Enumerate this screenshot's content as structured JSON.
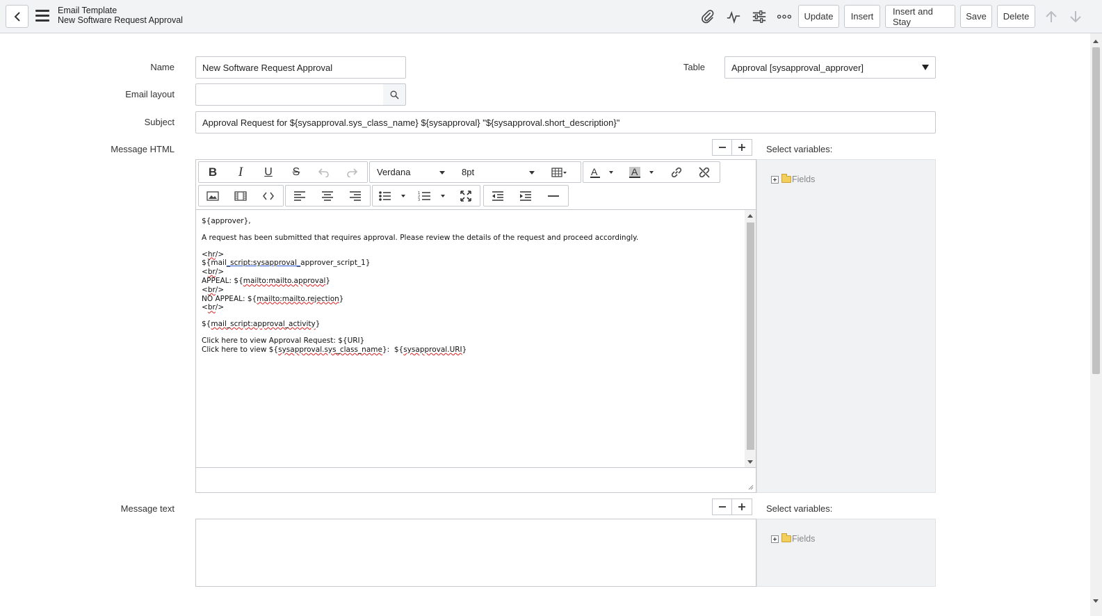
{
  "header": {
    "title": "Email Template",
    "subtitle": "New Software Request Approval",
    "buttons": {
      "update": "Update",
      "insert": "Insert",
      "insert_and_stay": "Insert and Stay",
      "save": "Save",
      "delete": "Delete"
    },
    "icons": [
      "back-icon",
      "menu-icon",
      "paperclip-icon",
      "activity-icon",
      "sliders-icon",
      "more-icon",
      "arrow-up-icon",
      "arrow-down-icon"
    ]
  },
  "form": {
    "name_label": "Name",
    "name_value": "New Software Request Approval",
    "email_layout_label": "Email layout",
    "email_layout_value": "",
    "table_label": "Table",
    "table_value": "Approval [sysapproval_approver]",
    "subject_label": "Subject",
    "subject_value": "Approval Request for ${sysapproval.sys_class_name} ${sysapproval} \"${sysapproval.short_description}\"",
    "message_html_label": "Message HTML",
    "message_text_label": "Message text",
    "select_variables_label": "Select variables:",
    "fields_node": "Fields"
  },
  "editor": {
    "font": "Verdana",
    "size": "8pt",
    "content": {
      "l1": "${approver},",
      "l2": "A request has been submitted that requires approval. Please review the details of the request and proceed accordingly.",
      "l3_pre": "<",
      "l3_u": "hr",
      "l3_post": "/>",
      "l4_pre": "${mail",
      "l4_u": "_script:sysapproval_",
      "l4_post": "approver_script_1}",
      "l5_pre": "<",
      "l5_u": "br",
      "l5_post": "/>",
      "l6_pre": "APPEAL: ${",
      "l6_u": "mailto:mailto.approval",
      "l6_post": "}",
      "l7_pre": "<",
      "l7_u": "br",
      "l7_post": "/>",
      "l8_pre": "NO APPEAL: ${",
      "l8_u": "mailto:mailto.rejection",
      "l8_post": "}",
      "l9_pre": "<",
      "l9_u": "br",
      "l9_post": "/>",
      "l10_pre": "${",
      "l10_u": "mail_script:approval_activity",
      "l10_post": "}",
      "l11": "Click here to view Approval Request: ${URI}",
      "l12_pre": "Click here to view ${",
      "l12_u1": "sysapproval.sys_class_name",
      "l12_mid": "}:  ${",
      "l12_u2": "sysapproval.URI",
      "l12_post": "}"
    }
  },
  "colors": {
    "header_bg": "#f2f3f4",
    "panel_bg": "#f1f2f3",
    "border": "#c5c9cd"
  }
}
